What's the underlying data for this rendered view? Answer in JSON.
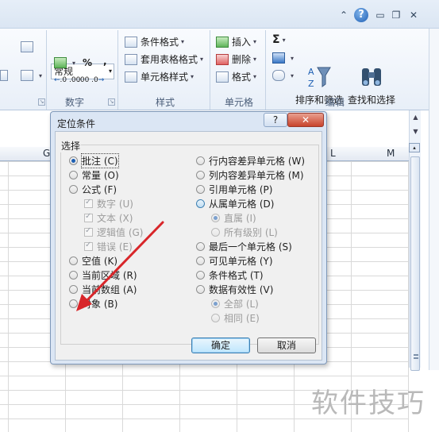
{
  "ribbon": {
    "number_format": "常规",
    "percent": "%",
    "comma": ",",
    "dec_up": "←.0\n.00",
    "dec_down": ".00\n→.0",
    "styles": {
      "conditional": "条件格式",
      "table": "套用表格格式",
      "cell": "单元格样式"
    },
    "cells": {
      "insert": "插入",
      "delete": "删除",
      "format": "格式"
    },
    "editing": {
      "sigma": "Σ",
      "sort_filter": "排序和筛选",
      "find_select": "查找和选择"
    },
    "groups": {
      "number": "数字",
      "styles": "样式",
      "cells": "单元格",
      "editing": "编辑"
    }
  },
  "sheet": {
    "columns": [
      "G",
      "L",
      "M"
    ]
  },
  "watermark": "软件技巧",
  "dialog": {
    "title": "定位条件",
    "help": "?",
    "close": "✕",
    "group": "选择",
    "left_options": [
      "批注 (C)",
      "常量 (O)",
      "公式 (F)"
    ],
    "formula_sub": [
      "数字 (U)",
      "文本 (X)",
      "逻辑值 (G)",
      "错误 (E)"
    ],
    "left_more": [
      "空值 (K)",
      "当前区域 (R)",
      "当前数组 (A)",
      "对象 (B)"
    ],
    "right_options": [
      "行内容差异单元格 (W)",
      "列内容差异单元格 (M)",
      "引用单元格 (P)",
      "从属单元格 (D)"
    ],
    "dependents_sub": [
      "直属 (I)",
      "所有级别 (L)"
    ],
    "right_more": [
      "最后一个单元格 (S)",
      "可见单元格 (Y)",
      "条件格式 (T)",
      "数据有效性 (V)"
    ],
    "validation_sub": [
      "全部 (L)",
      "相同 (E)"
    ],
    "ok": "确定",
    "cancel": "取消"
  }
}
